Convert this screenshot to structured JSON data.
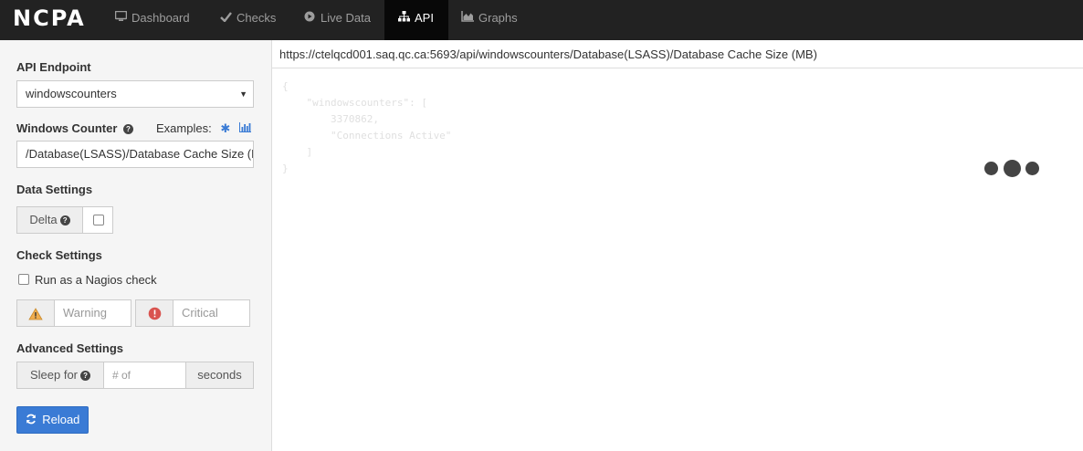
{
  "brand": "NCPA",
  "nav": [
    {
      "label": "Dashboard",
      "icon": "monitor-icon",
      "active": false
    },
    {
      "label": "Checks",
      "icon": "check-icon",
      "active": false
    },
    {
      "label": "Live Data",
      "icon": "play-circle-icon",
      "active": false
    },
    {
      "label": "API",
      "icon": "sitemap-icon",
      "active": true
    },
    {
      "label": "Graphs",
      "icon": "area-chart-icon",
      "active": false
    }
  ],
  "sidebar": {
    "endpoint_title": "API Endpoint",
    "endpoint_value": "windowscounters",
    "counter_title": "Windows Counter",
    "examples_label": "Examples:",
    "counter_value": "/Database(LSASS)/Database Cache Size (MB)",
    "data_settings_title": "Data Settings",
    "delta_label": "Delta",
    "check_settings_title": "Check Settings",
    "nagios_check_label": "Run as a Nagios check",
    "warning_placeholder": "Warning",
    "critical_placeholder": "Critical",
    "advanced_settings_title": "Advanced Settings",
    "sleep_label": "Sleep for",
    "sleep_placeholder": "# of",
    "seconds_label": "seconds",
    "reload_label": "Reload"
  },
  "main": {
    "url": "https://ctelqcd001.saq.qc.ca:5693/api/windowscounters/Database(LSASS)/Database Cache Size (MB)",
    "json_lines": [
      "{",
      "    \"windowscounters\": [",
      "        3370862,",
      "        \"Connections Active\"",
      "    ]",
      "}"
    ]
  },
  "colors": {
    "navbar": "#222222",
    "accent": "#3a7bd5",
    "warning": "#f0ad4e",
    "danger": "#d9534f"
  }
}
